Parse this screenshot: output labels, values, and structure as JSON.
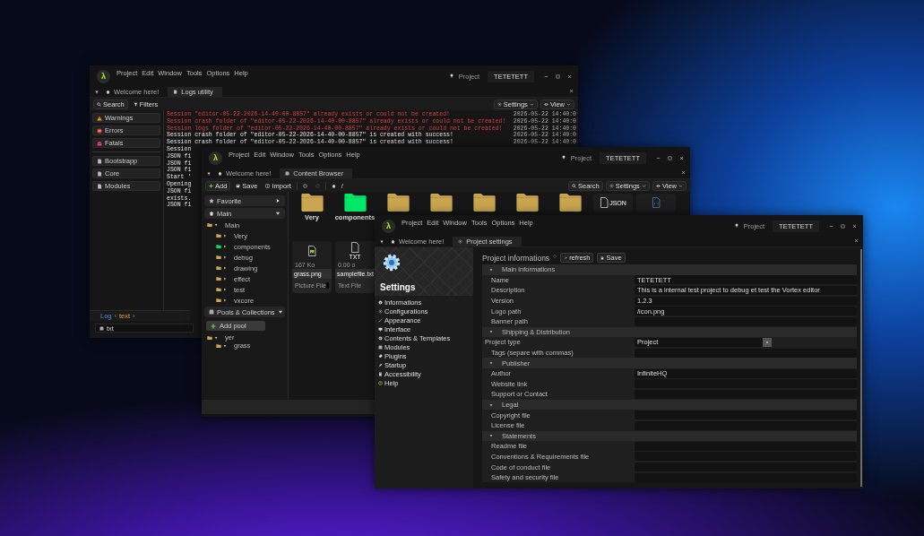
{
  "logs_window": {
    "logo": "λ",
    "menu": [
      "Project",
      "Edit",
      "Window",
      "Tools",
      "Options",
      "Help"
    ],
    "project_label": "Project",
    "project_name": "TETETETT",
    "tabs": [
      {
        "label": "Welcome here!",
        "selected": false
      },
      {
        "label": "Logs utility",
        "selected": true
      }
    ],
    "toolbar": {
      "search": "Search",
      "filters": "Filters",
      "settings": "Settings",
      "view": "View"
    },
    "levels": [
      {
        "label": "Warnings",
        "kind": "warning"
      },
      {
        "label": "Errors",
        "kind": "error"
      },
      {
        "label": "Fatals",
        "kind": "fatal"
      }
    ],
    "sources": [
      "Bootstrapp",
      "Core",
      "Modules"
    ],
    "lines": [
      {
        "text": "Session \"editor-05-22-2026-14-40-00-8857\" already exists or could not be created!",
        "time": "2026-05-22 14:40:0",
        "kind": "error"
      },
      {
        "text": "Session crash folder of \"editor-05-22-2026-14-40-00-8857\" already exists or could not be created!",
        "time": "2026-05-22 14:40:0",
        "kind": "error"
      },
      {
        "text": "Session logs folder of \"editor-05-22-2026-14-40-00-8857\" already exists or could not be created!",
        "time": "2026-05-22 14:40:0",
        "kind": "error"
      },
      {
        "text": "Session crash folder of \"editor-05-22-2026-14-40-00-8857\" is created with success!",
        "time": "2026-05-22 14:40:0",
        "kind": "info"
      },
      {
        "text": "Session crash folder of \"editor-05-22-2026-14-40-00-8857\" is created with success!",
        "time": "2026-05-22 14:40:0",
        "kind": "info"
      },
      {
        "text": "Session",
        "kind": "info"
      },
      {
        "text": "JSON fi",
        "kind": "info"
      },
      {
        "text": "JSON fi",
        "kind": "info"
      },
      {
        "text": "JSON fi",
        "kind": "info"
      },
      {
        "text": "Start '",
        "kind": "info"
      },
      {
        "text": "Opening",
        "kind": "info"
      },
      {
        "text": "JSON fi",
        "kind": "info"
      },
      {
        "text": "exists.",
        "kind": "info"
      },
      {
        "text": "JSON fi",
        "kind": "info"
      }
    ],
    "breadcrumb": [
      {
        "text": "Log",
        "kind": "root"
      },
      {
        "text": "‹",
        "kind": "separator"
      },
      {
        "text": "text",
        "kind": "segment"
      },
      {
        "text": "›",
        "kind": "separator"
      }
    ],
    "input": {
      "value": "txt"
    }
  },
  "content_browser_window": {
    "logo": "λ",
    "menu": [
      "Project",
      "Edit",
      "Window",
      "Tools",
      "Options",
      "Help"
    ],
    "project_label": "Project",
    "project_name": "TETETETT",
    "tabs": [
      {
        "label": "Welcome here!",
        "selected": false
      },
      {
        "label": "Content Browser",
        "selected": true
      }
    ],
    "toolbar": {
      "add": "Add",
      "save": "Save",
      "import": "Import",
      "path": "/",
      "search": "Search",
      "settings": "Settings",
      "view": "View"
    },
    "favorite": {
      "label": "Favorite",
      "expanded": false
    },
    "main": {
      "label": "Main",
      "expanded": true
    },
    "tree": [
      {
        "label": "Main",
        "color": "#c9a64f",
        "expanded": true,
        "children": [
          {
            "label": "Very",
            "color": "#c9a64f",
            "expanded": false
          },
          {
            "label": "components",
            "color": "#00e060",
            "expanded": false
          },
          {
            "label": "debug",
            "color": "#c9a64f",
            "expanded": false
          },
          {
            "label": "drawing",
            "color": "#c9a64f",
            "expanded": false
          },
          {
            "label": "effect",
            "color": "#c9a64f",
            "expanded": false
          },
          {
            "label": "test",
            "color": "#c9a64f",
            "expanded": false
          },
          {
            "label": "vxcore",
            "color": "#c9a64f",
            "expanded": false
          }
        ]
      }
    ],
    "pools": {
      "label": "Pools & Collections",
      "expanded": true
    },
    "add_pool": "Add pool",
    "pool_tree": [
      {
        "label": "yer",
        "color": "#c9a64f",
        "expanded": true,
        "children": [
          {
            "label": "grass",
            "color": "#c9a64f",
            "expanded": true
          }
        ]
      }
    ],
    "items": [
      {
        "kind": "folder",
        "label": "Very",
        "color": "#c9a64f"
      },
      {
        "kind": "folder",
        "label": "components",
        "color": "#00e868"
      },
      {
        "kind": "folder",
        "color": "#c9a64f"
      },
      {
        "kind": "folder",
        "color": "#c9a64f"
      },
      {
        "kind": "folder",
        "color": "#c9a64f"
      },
      {
        "kind": "folder",
        "color": "#c9a64f"
      },
      {
        "kind": "folder",
        "color": "#c9a64f"
      },
      {
        "kind": "file",
        "badge": "JSON"
      },
      {
        "kind": "code"
      },
      {
        "kind": "picture",
        "size": "167 Ko",
        "label": "grass.png",
        "type": "Picture File"
      },
      {
        "kind": "text",
        "badge": "TXT",
        "size": "0.00 o",
        "label": "samplefile.txt",
        "type": "Text File"
      }
    ]
  },
  "settings_window": {
    "logo": "λ",
    "menu": [
      "Project",
      "Edit",
      "Window",
      "Tools",
      "Options",
      "Help"
    ],
    "project_label": "Project",
    "project_name": "TETETETT",
    "tabs": [
      {
        "label": "Welcome here!",
        "selected": false
      },
      {
        "label": "Project settings",
        "selected": true
      }
    ],
    "banner_title": "Settings",
    "nav": [
      "Informations",
      "Configurations",
      "Appearance",
      "Interface",
      "Contents & Templates",
      "Modules",
      "Plugins",
      "Startup",
      "Accessibility",
      "Help"
    ],
    "header": {
      "title": "Project informations",
      "refresh": "refresh",
      "save": "Save"
    },
    "sections": [
      {
        "title": "Main informations",
        "expanded": true,
        "fields": [
          {
            "label": "Name",
            "kind": "text",
            "value": "TETETETT"
          },
          {
            "label": "Description",
            "kind": "text",
            "value": "This is a internal test project to debug et test the Vortex editor"
          },
          {
            "label": "Version",
            "kind": "text",
            "value": "1.2.3"
          },
          {
            "label": "Logo path",
            "kind": "text",
            "value": "/icon.png"
          },
          {
            "label": "Banner path",
            "kind": "text"
          }
        ]
      },
      {
        "title": "Shipping & Distribution",
        "expanded": true,
        "fields": [
          {
            "label": "Project type",
            "kind": "dropdown",
            "value": "Project"
          },
          {
            "label": "Tags (separe with commas)",
            "kind": "text"
          }
        ]
      },
      {
        "title": "Publisher",
        "expanded": true,
        "fields": [
          {
            "label": "Author",
            "kind": "text",
            "value": "InfiniteHQ"
          },
          {
            "label": "Website link",
            "kind": "text"
          },
          {
            "label": "Support or Contact",
            "kind": "text"
          }
        ]
      },
      {
        "title": "Legal",
        "expanded": true,
        "fields": [
          {
            "label": "Copyright file",
            "kind": "text"
          },
          {
            "label": "License file",
            "kind": "text"
          }
        ]
      },
      {
        "title": "Statements",
        "expanded": true,
        "fields": [
          {
            "label": "Readme file",
            "kind": "text"
          },
          {
            "label": "Conventions & Requirements file",
            "kind": "text"
          },
          {
            "label": "Code of conduct file",
            "kind": "text"
          },
          {
            "label": "Safety and security file",
            "kind": "text"
          }
        ]
      }
    ]
  }
}
